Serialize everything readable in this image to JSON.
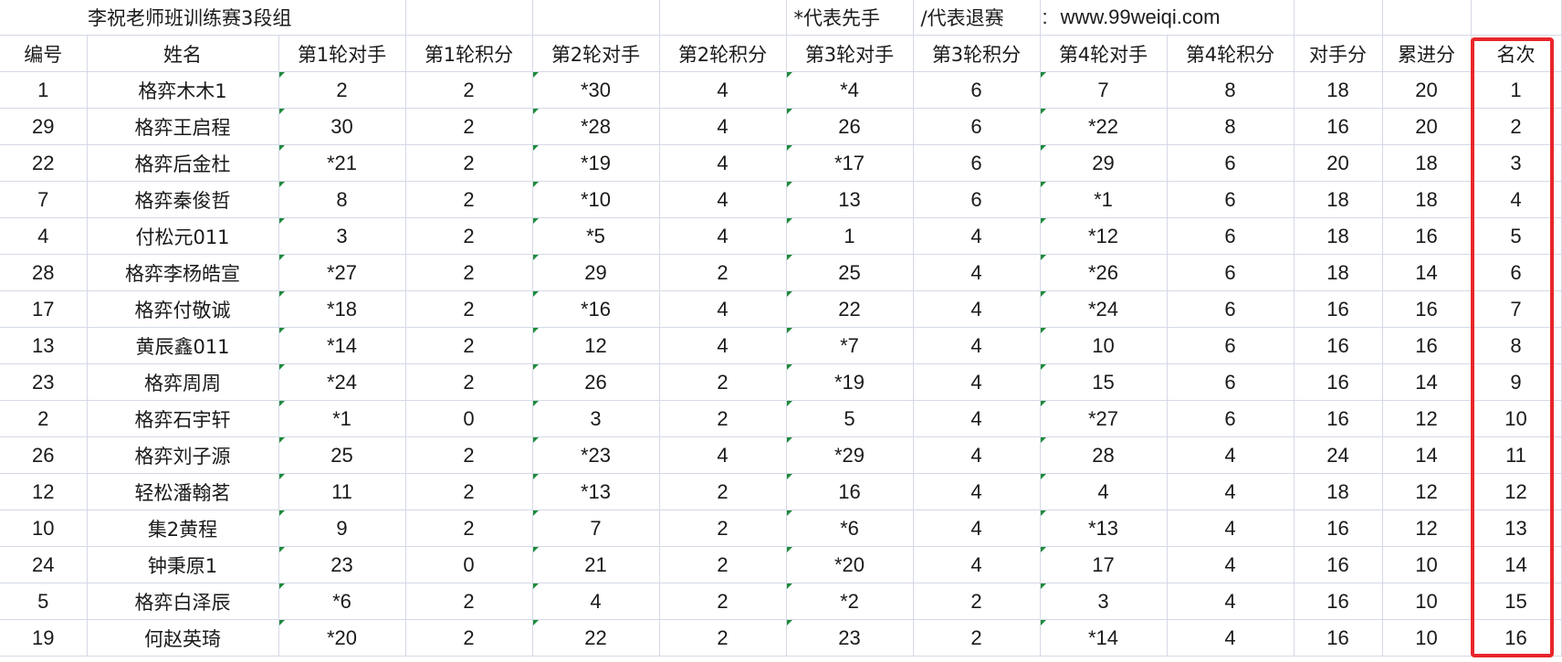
{
  "header": {
    "title": "李祝老师班训练赛3段组",
    "note_black_first": "*代表先手",
    "note_withdraw": "/代表退赛",
    "colon": ":",
    "website": "www.99weiqi.com"
  },
  "columns": [
    "编号",
    "姓名",
    "第1轮对手",
    "第1轮积分",
    "第2轮对手",
    "第2轮积分",
    "第3轮对手",
    "第3轮积分",
    "第4轮对手",
    "第4轮积分",
    "对手分",
    "累进分",
    "名次"
  ],
  "rows": [
    {
      "id": "1",
      "name": "格弈木木1",
      "r1_opp": "2",
      "r1_pts": "2",
      "r2_opp": "*30",
      "r2_pts": "4",
      "r3_opp": "*4",
      "r3_pts": "6",
      "r4_opp": "7",
      "r4_pts": "8",
      "opp_score": "18",
      "cumulative": "20",
      "rank": "1"
    },
    {
      "id": "29",
      "name": "格弈王启程",
      "r1_opp": "30",
      "r1_pts": "2",
      "r2_opp": "*28",
      "r2_pts": "4",
      "r3_opp": "26",
      "r3_pts": "6",
      "r4_opp": "*22",
      "r4_pts": "8",
      "opp_score": "16",
      "cumulative": "20",
      "rank": "2"
    },
    {
      "id": "22",
      "name": "格弈后金杜",
      "r1_opp": "*21",
      "r1_pts": "2",
      "r2_opp": "*19",
      "r2_pts": "4",
      "r3_opp": "*17",
      "r3_pts": "6",
      "r4_opp": "29",
      "r4_pts": "6",
      "opp_score": "20",
      "cumulative": "18",
      "rank": "3"
    },
    {
      "id": "7",
      "name": "格弈秦俊哲",
      "r1_opp": "8",
      "r1_pts": "2",
      "r2_opp": "*10",
      "r2_pts": "4",
      "r3_opp": "13",
      "r3_pts": "6",
      "r4_opp": "*1",
      "r4_pts": "6",
      "opp_score": "18",
      "cumulative": "18",
      "rank": "4"
    },
    {
      "id": "4",
      "name": "付松元011",
      "r1_opp": "3",
      "r1_pts": "2",
      "r2_opp": "*5",
      "r2_pts": "4",
      "r3_opp": "1",
      "r3_pts": "4",
      "r4_opp": "*12",
      "r4_pts": "6",
      "opp_score": "18",
      "cumulative": "16",
      "rank": "5"
    },
    {
      "id": "28",
      "name": "格弈李杨皓宣",
      "r1_opp": "*27",
      "r1_pts": "2",
      "r2_opp": "29",
      "r2_pts": "2",
      "r3_opp": "25",
      "r3_pts": "4",
      "r4_opp": "*26",
      "r4_pts": "6",
      "opp_score": "18",
      "cumulative": "14",
      "rank": "6"
    },
    {
      "id": "17",
      "name": "格弈付敬诚",
      "r1_opp": "*18",
      "r1_pts": "2",
      "r2_opp": "*16",
      "r2_pts": "4",
      "r3_opp": "22",
      "r3_pts": "4",
      "r4_opp": "*24",
      "r4_pts": "6",
      "opp_score": "16",
      "cumulative": "16",
      "rank": "7"
    },
    {
      "id": "13",
      "name": "黄辰鑫011",
      "r1_opp": "*14",
      "r1_pts": "2",
      "r2_opp": "12",
      "r2_pts": "4",
      "r3_opp": "*7",
      "r3_pts": "4",
      "r4_opp": "10",
      "r4_pts": "6",
      "opp_score": "16",
      "cumulative": "16",
      "rank": "8"
    },
    {
      "id": "23",
      "name": "格弈周周",
      "r1_opp": "*24",
      "r1_pts": "2",
      "r2_opp": "26",
      "r2_pts": "2",
      "r3_opp": "*19",
      "r3_pts": "4",
      "r4_opp": "15",
      "r4_pts": "6",
      "opp_score": "16",
      "cumulative": "14",
      "rank": "9"
    },
    {
      "id": "2",
      "name": "格弈石宇轩",
      "r1_opp": "*1",
      "r1_pts": "0",
      "r2_opp": "3",
      "r2_pts": "2",
      "r3_opp": "5",
      "r3_pts": "4",
      "r4_opp": "*27",
      "r4_pts": "6",
      "opp_score": "16",
      "cumulative": "12",
      "rank": "10"
    },
    {
      "id": "26",
      "name": "格弈刘子源",
      "r1_opp": "25",
      "r1_pts": "2",
      "r2_opp": "*23",
      "r2_pts": "4",
      "r3_opp": "*29",
      "r3_pts": "4",
      "r4_opp": "28",
      "r4_pts": "4",
      "opp_score": "24",
      "cumulative": "14",
      "rank": "11"
    },
    {
      "id": "12",
      "name": "轻松潘翰茗",
      "r1_opp": "11",
      "r1_pts": "2",
      "r2_opp": "*13",
      "r2_pts": "2",
      "r3_opp": "16",
      "r3_pts": "4",
      "r4_opp": "4",
      "r4_pts": "4",
      "opp_score": "18",
      "cumulative": "12",
      "rank": "12"
    },
    {
      "id": "10",
      "name": "集2黄程",
      "r1_opp": "9",
      "r1_pts": "2",
      "r2_opp": "7",
      "r2_pts": "2",
      "r3_opp": "*6",
      "r3_pts": "4",
      "r4_opp": "*13",
      "r4_pts": "4",
      "opp_score": "16",
      "cumulative": "12",
      "rank": "13"
    },
    {
      "id": "24",
      "name": "钟秉原1",
      "r1_opp": "23",
      "r1_pts": "0",
      "r2_opp": "21",
      "r2_pts": "2",
      "r3_opp": "*20",
      "r3_pts": "4",
      "r4_opp": "17",
      "r4_pts": "4",
      "opp_score": "16",
      "cumulative": "10",
      "rank": "14"
    },
    {
      "id": "5",
      "name": "格弈白泽辰",
      "r1_opp": "*6",
      "r1_pts": "2",
      "r2_opp": "4",
      "r2_pts": "2",
      "r3_opp": "*2",
      "r3_pts": "2",
      "r4_opp": "3",
      "r4_pts": "4",
      "opp_score": "16",
      "cumulative": "10",
      "rank": "15"
    },
    {
      "id": "19",
      "name": "何赵英琦",
      "r1_opp": "*20",
      "r1_pts": "2",
      "r2_opp": "22",
      "r2_pts": "2",
      "r3_opp": "23",
      "r3_pts": "2",
      "r4_opp": "*14",
      "r4_pts": "4",
      "opp_score": "16",
      "cumulative": "10",
      "rank": "16"
    }
  ],
  "colors": {
    "grid_line": "#d5d9e6",
    "rank_highlight": "#e8262a",
    "cell_marker": "#1e8a3c",
    "text": "#1a1a1a"
  }
}
